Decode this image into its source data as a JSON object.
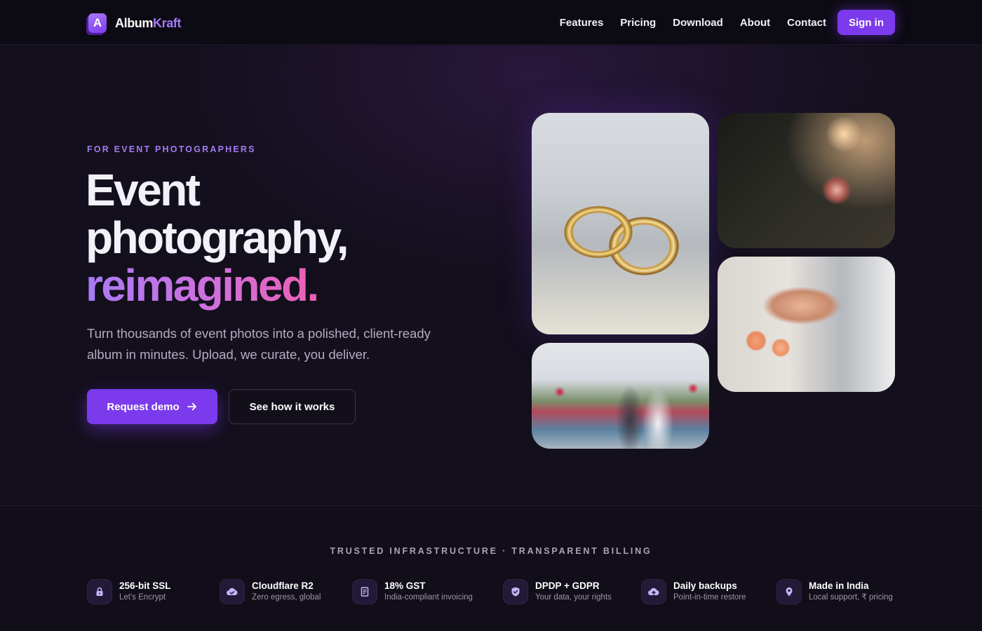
{
  "brand": {
    "name_part1": "Album",
    "name_part2": "Kraft",
    "mark_letter": "A"
  },
  "nav": {
    "links": [
      "Features",
      "Pricing",
      "Download",
      "About",
      "Contact"
    ],
    "sign_in": "Sign in"
  },
  "hero": {
    "eyebrow": "FOR EVENT PHOTOGRAPHERS",
    "headline_line1": "Event",
    "headline_line2": "photography,",
    "headline_accent": "reimagined.",
    "subtitle": "Turn thousands of event photos into a polished, client-ready album in minutes. Upload, we curate, you deliver.",
    "primary_cta": "Request demo",
    "secondary_cta": "See how it works"
  },
  "trust": {
    "title": "TRUSTED INFRASTRUCTURE · TRANSPARENT BILLING",
    "badges": [
      {
        "title": "256-bit SSL",
        "sub": "Let's Encrypt",
        "icon": "lock-icon"
      },
      {
        "title": "Cloudflare R2",
        "sub": "Zero egress, global",
        "icon": "cloud-check-icon"
      },
      {
        "title": "18% GST",
        "sub": "India-compliant invoicing",
        "icon": "receipt-icon"
      },
      {
        "title": "DPDP + GDPR",
        "sub": "Your data, your rights",
        "icon": "shield-check-icon"
      },
      {
        "title": "Daily backups",
        "sub": "Point-in-time restore",
        "icon": "cloud-upload-icon"
      },
      {
        "title": "Made in India",
        "sub": "Local support, ₹ pricing",
        "icon": "map-pin-icon"
      }
    ]
  },
  "colors": {
    "accent": "#7c3aed",
    "accent_light": "#a679f5",
    "gradient_end": "#ec5fb3",
    "background": "#110d1a"
  }
}
